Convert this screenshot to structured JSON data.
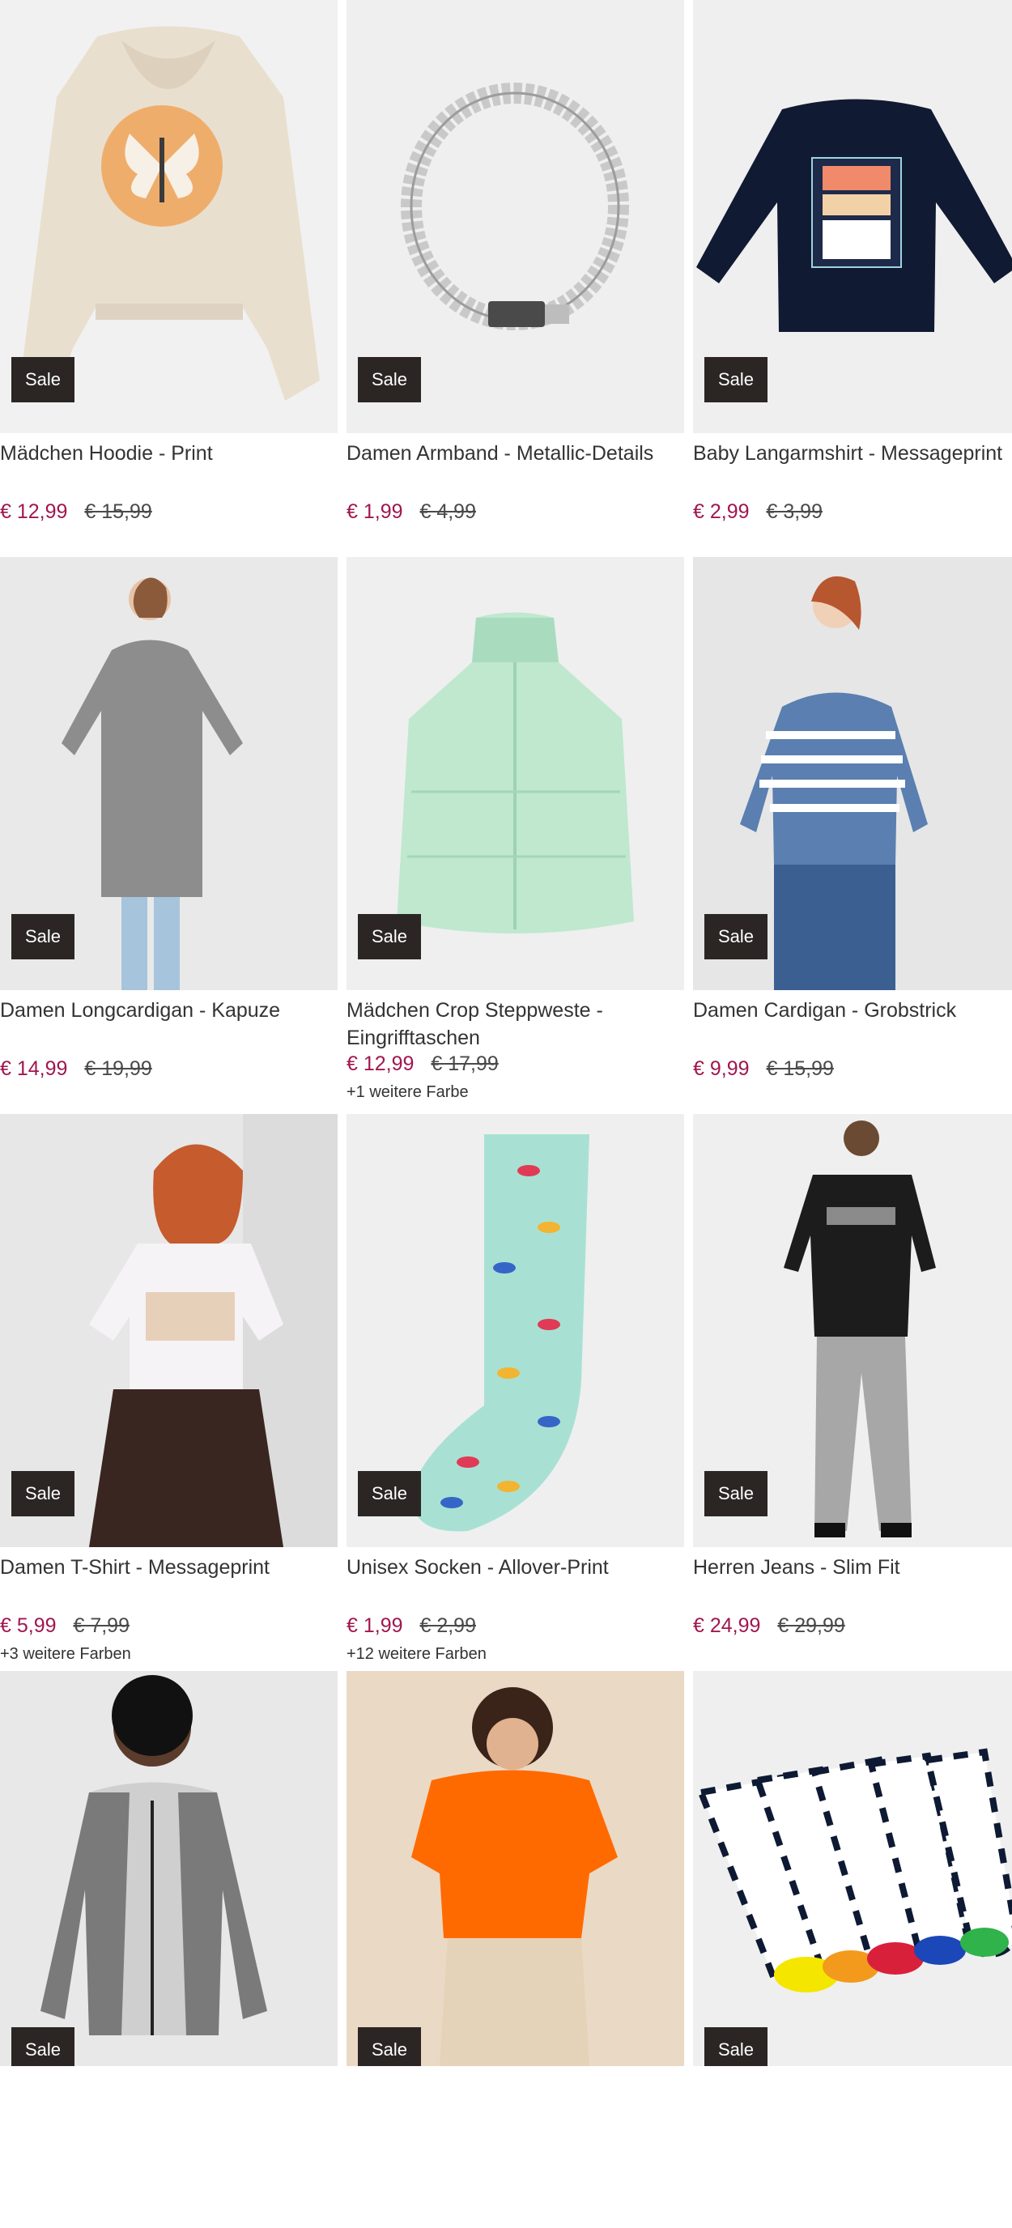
{
  "sale_badge": "Sale",
  "products": [
    {
      "title": "Mädchen Hoodie - Print",
      "price": "€ 12,99",
      "old_price": "€ 15,99",
      "more": "",
      "image": "hoodie-beige-butterfly"
    },
    {
      "title": "Damen Armband - Metallic-Details",
      "price": "€ 1,99",
      "old_price": "€ 4,99",
      "more": "",
      "image": "silver-bracelet"
    },
    {
      "title": "Baby Langarmshirt - Messageprint",
      "price": "€ 2,99",
      "old_price": "€ 3,99",
      "more": "",
      "image": "navy-longsleeve-enjoy-today"
    },
    {
      "title": "Damen Longcardigan - Kapuze",
      "price": "€ 14,99",
      "old_price": "€ 19,99",
      "more": "",
      "image": "grey-long-cardigan"
    },
    {
      "title": "Mädchen Crop Steppweste - Eingrifftaschen",
      "price": "€ 12,99",
      "old_price": "€ 17,99",
      "more": "+1 weitere Farbe",
      "image": "mint-puffer-vest"
    },
    {
      "title": "Damen Cardigan - Grobstrick",
      "price": "€ 9,99",
      "old_price": "€ 15,99",
      "more": "",
      "image": "blue-striped-cardigan"
    },
    {
      "title": "Damen T-Shirt - Messageprint",
      "price": "€ 5,99",
      "old_price": "€ 7,99",
      "more": "+3 weitere Farben",
      "image": "white-tshirt-print"
    },
    {
      "title": "Unisex Socken - Allover-Print",
      "price": "€ 1,99",
      "old_price": "€ 2,99",
      "more": "+12 weitere Farben",
      "image": "mint-parrot-sock"
    },
    {
      "title": "Herren Jeans - Slim Fit",
      "price": "€ 24,99",
      "old_price": "€ 29,99",
      "more": "",
      "image": "grey-slim-jeans"
    },
    {
      "title": "",
      "price": "",
      "old_price": "",
      "more": "",
      "image": "grey-raglan-zip-jacket"
    },
    {
      "title": "",
      "price": "",
      "old_price": "",
      "more": "",
      "image": "orange-top"
    },
    {
      "title": "",
      "price": "",
      "old_price": "",
      "more": "",
      "image": "striped-sneaker-socks"
    }
  ],
  "colors": {
    "sale_price": "#a0174f",
    "badge_bg": "#2b2624"
  }
}
